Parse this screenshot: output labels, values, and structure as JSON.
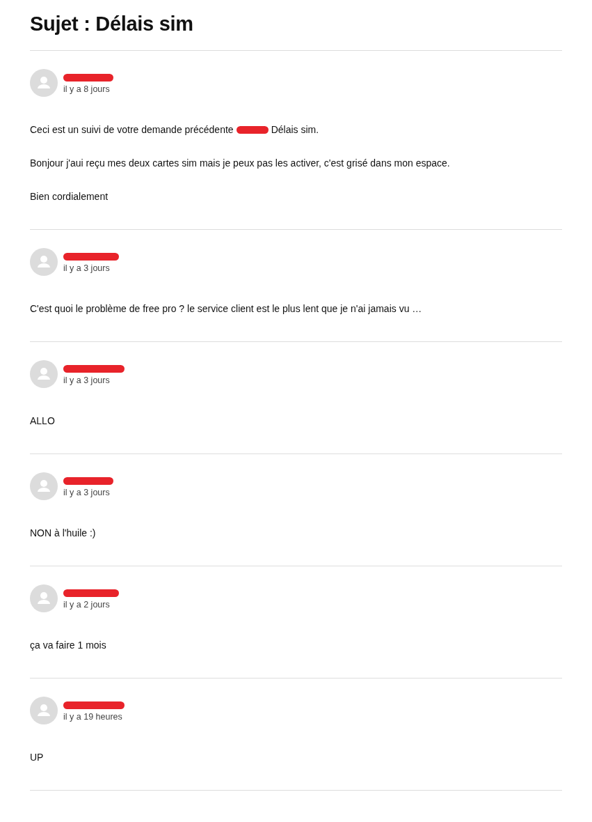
{
  "title": "Sujet : Délais sim",
  "messages": [
    {
      "author_redacted": true,
      "time": "il y a 8 jours",
      "paragraphs": [
        [
          {
            "kind": "text",
            "text": "Ceci est un suivi de votre demande précédente"
          },
          {
            "kind": "redaction"
          },
          {
            "kind": "text",
            "text": "Délais sim."
          }
        ],
        [
          {
            "kind": "text",
            "text": "Bonjour j'aui reçu mes deux cartes sim mais je peux pas les activer, c'est grisé dans mon espace."
          }
        ],
        [
          {
            "kind": "text",
            "text": "Bien cordialement"
          }
        ]
      ]
    },
    {
      "author_redacted": true,
      "time": "il y a 3 jours",
      "paragraphs": [
        [
          {
            "kind": "text",
            "text": "C'est quoi le problème de free pro ? le service client est le plus lent que je n'ai jamais vu …"
          }
        ]
      ]
    },
    {
      "author_redacted": true,
      "time": "il y a 3 jours",
      "paragraphs": [
        [
          {
            "kind": "text",
            "text": "ALLO"
          }
        ]
      ]
    },
    {
      "author_redacted": true,
      "time": "il y a 3 jours",
      "paragraphs": [
        [
          {
            "kind": "text",
            "text": "NON à l'huile :)"
          }
        ]
      ]
    },
    {
      "author_redacted": true,
      "time": "il y a 2 jours",
      "paragraphs": [
        [
          {
            "kind": "text",
            "text": "ça va faire 1 mois"
          }
        ]
      ]
    },
    {
      "author_redacted": true,
      "time": "il y a 19 heures",
      "paragraphs": [
        [
          {
            "kind": "text",
            "text": "UP"
          }
        ]
      ]
    }
  ]
}
